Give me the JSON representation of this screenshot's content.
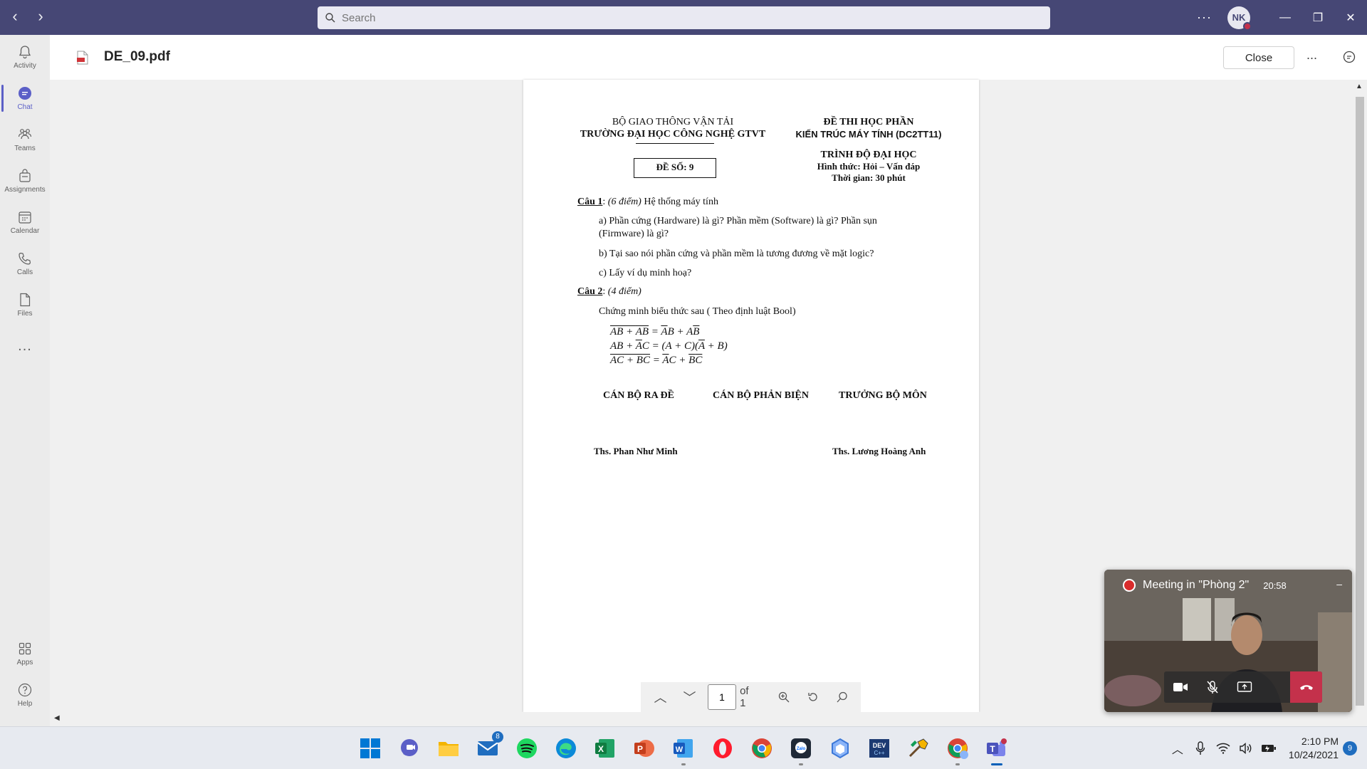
{
  "titlebar": {
    "search_placeholder": "Search",
    "avatar_initials": "NK"
  },
  "rail": {
    "items": [
      {
        "label": "Activity"
      },
      {
        "label": "Chat"
      },
      {
        "label": "Teams"
      },
      {
        "label": "Assignments"
      },
      {
        "label": "Calendar"
      },
      {
        "label": "Calls"
      },
      {
        "label": "Files"
      },
      {
        "label": "Apps"
      },
      {
        "label": "Help"
      }
    ],
    "more": "..."
  },
  "header": {
    "filename": "DE_09.pdf",
    "close_label": "Close",
    "more": "..."
  },
  "document": {
    "org_line1": "BỘ GIAO THÔNG VẬN TẢI",
    "org_line2": "TRƯỜNG ĐẠI HỌC CÔNG NGHỆ GTVT",
    "exam_title1": "ĐỀ THI HỌC PHẦN",
    "exam_title2": "KIẾN TRÚC MÁY TÍNH (DC2TT11)",
    "level": "TRÌNH ĐỘ ĐẠI HỌC",
    "form": "Hình thức: Hỏi – Vấn đáp",
    "time": "Thời gian: 30 phút",
    "de_so": "ĐỀ SỐ: 9",
    "q1_label": "Câu 1",
    "q1_points": "(6 điểm)",
    "q1_title": "Hệ thống máy tính",
    "q1_a": "a) Phần cứng (Hardware) là gì? Phần mềm (Software) là gì? Phần sụn (Firmware) là gì?",
    "q1_b": "b) Tại sao nói phần cứng và phần mềm là tương đương về mặt logic?",
    "q1_c": "c) Lấy ví dụ minh hoạ?",
    "q2_label": "Câu 2",
    "q2_points": "(4 điểm)",
    "q2_text": "Chứng minh biểu thức sau ( Theo định luật Bool)",
    "sig1": "CÁN BỘ RA ĐỀ",
    "sig2": "CÁN BỘ PHẢN BIỆN",
    "sig3": "TRƯỞNG BỘ MÔN",
    "name1": "Ths. Phan Như Minh",
    "name3": "Ths. Lương Hoàng Anh"
  },
  "pdf_toolbar": {
    "page_value": "1",
    "page_of": "of 1"
  },
  "meeting": {
    "title": "Meeting in \"Phòng 2\"",
    "duration": "20:58",
    "minimize": "–"
  },
  "taskbar": {
    "mail_badge": "8",
    "time": "2:10 PM",
    "date": "10/24/2021",
    "notifications": "9"
  }
}
